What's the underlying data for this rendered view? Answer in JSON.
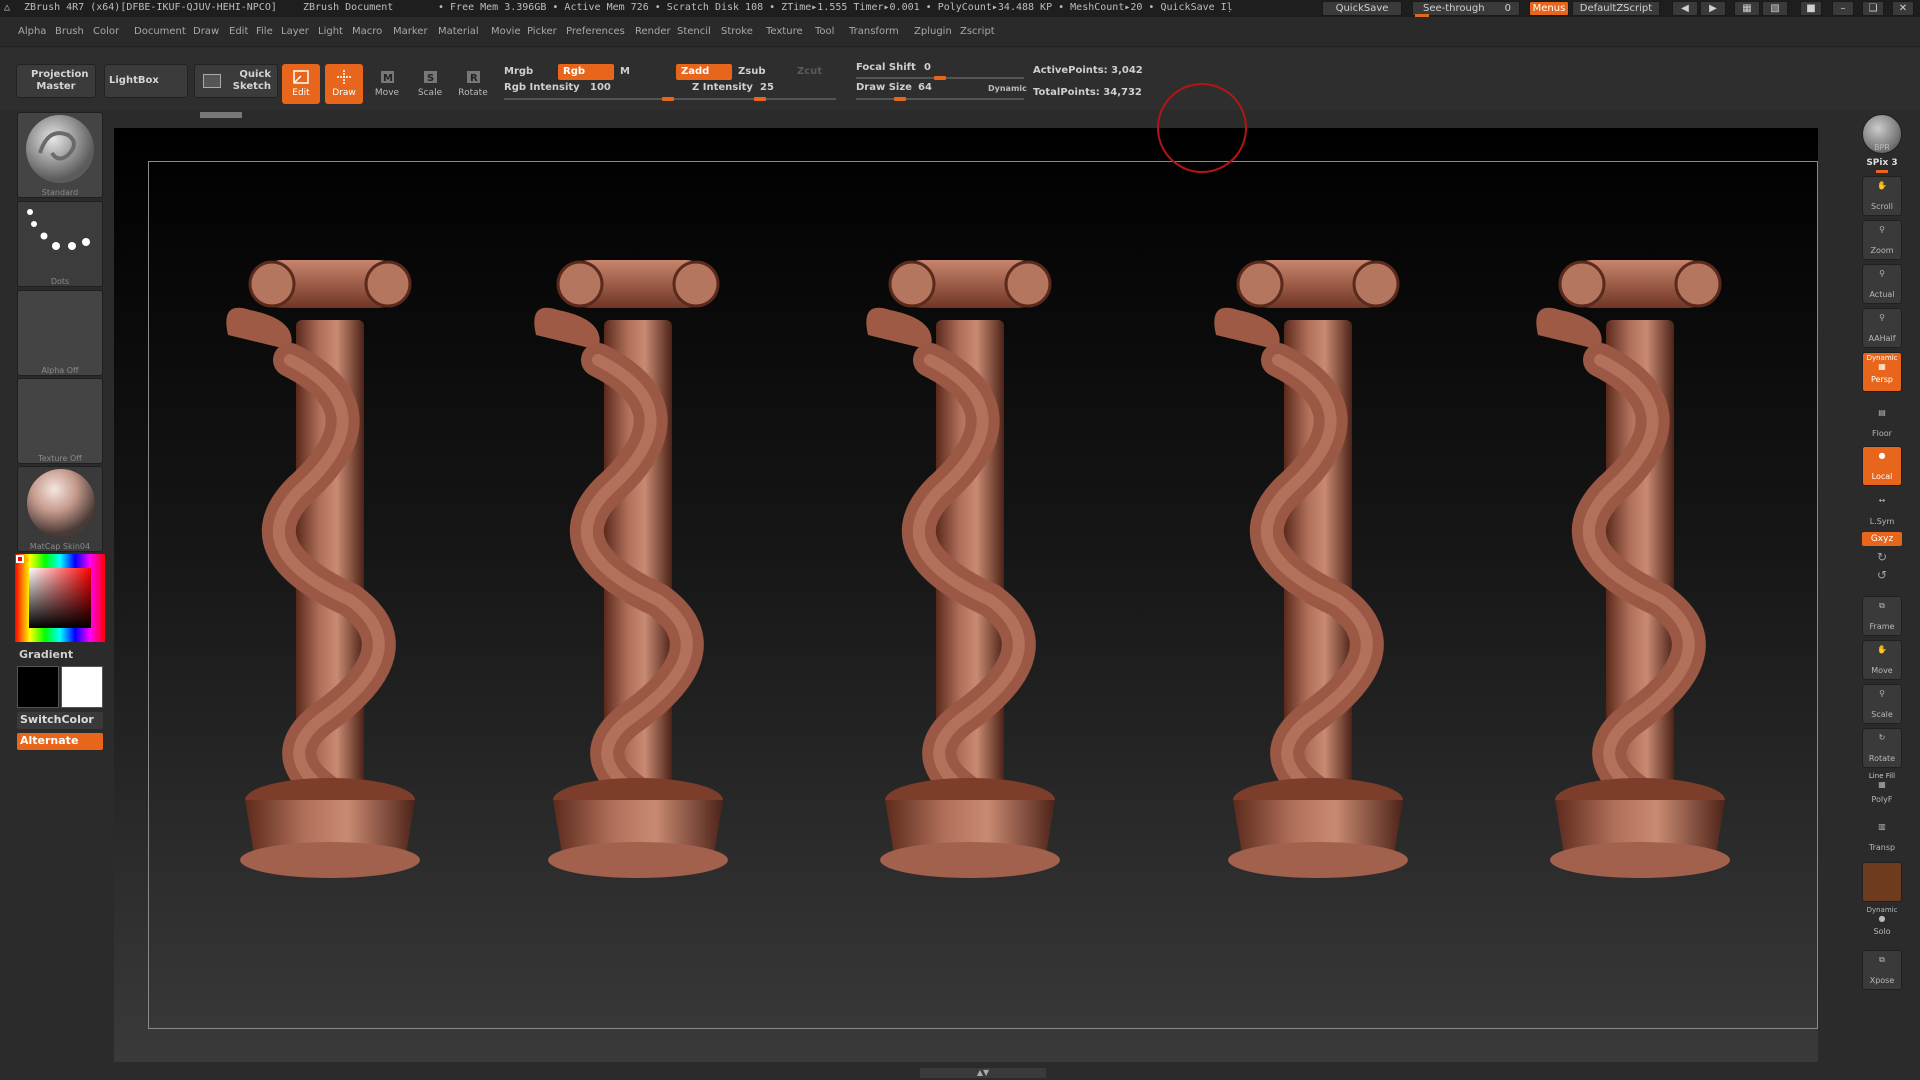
{
  "titlebar": {
    "app": "ZBrush 4R7 (x64)[DFBE-IKUF-QJUV-HEHI-NPCO]",
    "document": "ZBrush Document",
    "stats": "• Free Mem 3.396GB • Active Mem 726 • Scratch Disk 108 • ZTime▸1.555 Timer▸0.001 • PolyCount▸34.488 KP • MeshCount▸20 • QuickSave Iḷ",
    "quicksave": "QuickSave",
    "see_through": "See-through",
    "see_through_value": "0",
    "see_through_level": 0,
    "menus": "Menus",
    "default_zscript": "DefaultZScript"
  },
  "menubar": [
    "Alpha",
    "Brush",
    "Color",
    "Document",
    "Draw",
    "Edit",
    "File",
    "Layer",
    "Light",
    "Macro",
    "Marker",
    "Material",
    "Movie",
    "Picker",
    "Preferences",
    "Render",
    "Stencil",
    "Stroke",
    "Texture",
    "Tool",
    "Transform",
    "Zplugin",
    "Zscript"
  ],
  "shelf": {
    "projection_master": "Projection Master",
    "lightbox": "LightBox",
    "quick_sketch": "Quick Sketch",
    "edit": "Edit",
    "draw": "Draw",
    "move": "Move",
    "scale": "Scale",
    "rotate": "Rotate",
    "mrgb": "Mrgb",
    "rgb": "Rgb",
    "m": "M",
    "rgb_intensity": "Rgb Intensity",
    "rgb_intensity_value": "100",
    "zadd": "Zadd",
    "zsub": "Zsub",
    "zcut": "Zcut",
    "z_intensity": "Z Intensity",
    "z_intensity_value": "25",
    "focal_shift": "Focal Shift",
    "focal_shift_value": "0",
    "draw_size": "Draw Size",
    "draw_size_value": "64",
    "dynamic": "Dynamic",
    "active_points": "ActivePoints: 3,042",
    "total_points": "TotalPoints: 34,732"
  },
  "left": {
    "brush": "Standard",
    "stroke": "Dots",
    "alpha": "Alpha Off",
    "texture": "Texture Off",
    "material": "MatCap Skin04",
    "gradient": "Gradient",
    "switch_color": "SwitchColor",
    "alternate": "Alternate"
  },
  "right": {
    "bpr": "BPR",
    "spix": "SPix 3",
    "scroll": "Scroll",
    "zoom": "Zoom",
    "actual": "Actual",
    "aahalf": "AAHalf",
    "dynamic": "Dynamic",
    "persp": "Persp",
    "floor": "Floor",
    "local": "Local",
    "lsym": "L.Sym",
    "xyz": "Gxyz",
    "frame": "Frame",
    "move": "Move",
    "scale": "Scale",
    "rotate": "Rotate",
    "line_fill": "Line Fill",
    "polyf": "PolyF",
    "transp": "Transp",
    "dynamic2": "Dynamic",
    "solo": "Solo",
    "xpose": "Xpose"
  },
  "colors": {
    "accent": "#e8661c",
    "panel": "#2b2b2b",
    "sculpt": "#a9634f"
  }
}
